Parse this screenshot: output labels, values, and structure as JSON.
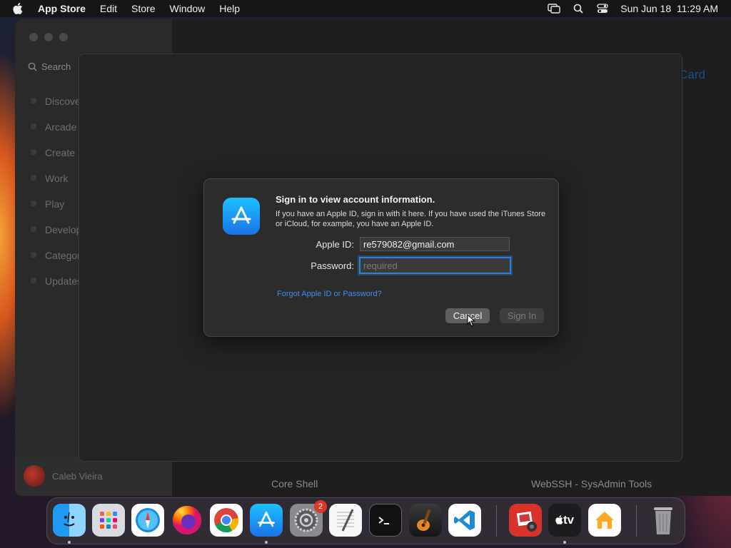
{
  "menubar": {
    "app_name": "App Store",
    "items": [
      "Edit",
      "Store",
      "Window",
      "Help"
    ],
    "datetime": "Sun Jun 18  11:29 AM"
  },
  "sidebar": {
    "search_placeholder": "Search",
    "items": [
      "Discover",
      "Arcade",
      "Create",
      "Work",
      "Play",
      "Develop",
      "Categories",
      "Updates"
    ],
    "user_name": "Caleb Vieira"
  },
  "main": {
    "link_text": "Card",
    "apps": [
      "Core Shell",
      "WebSSH - SysAdmin Tools"
    ]
  },
  "dialog": {
    "title": "Sign in to view account information.",
    "body": "If you have an Apple ID, sign in with it here. If you have used the iTunes Store or iCloud, for example, you have an Apple ID.",
    "apple_id_label": "Apple ID:",
    "apple_id_value": "re579082@gmail.com",
    "password_label": "Password:",
    "password_placeholder": "required",
    "forgot_link": "Forgot Apple ID or Password?",
    "cancel_label": "Cancel",
    "signin_label": "Sign In"
  },
  "dock": {
    "apps": [
      {
        "name": "finder-icon"
      },
      {
        "name": "launchpad-icon"
      },
      {
        "name": "safari-icon"
      },
      {
        "name": "firefox-icon"
      },
      {
        "name": "chrome-icon"
      },
      {
        "name": "app-store-icon"
      },
      {
        "name": "system-settings-icon",
        "badge": "2"
      },
      {
        "name": "textedit-icon"
      },
      {
        "name": "terminal-icon"
      },
      {
        "name": "garageband-icon"
      },
      {
        "name": "vscode-icon"
      },
      {
        "name": "photo-booth-icon"
      },
      {
        "name": "apple-tv-icon",
        "label": "tv"
      },
      {
        "name": "home-icon"
      },
      {
        "name": "trash-icon"
      }
    ]
  },
  "colors": {
    "accent": "#2f7fd8",
    "link": "#3b8ff0",
    "badge": "#e0352b"
  }
}
